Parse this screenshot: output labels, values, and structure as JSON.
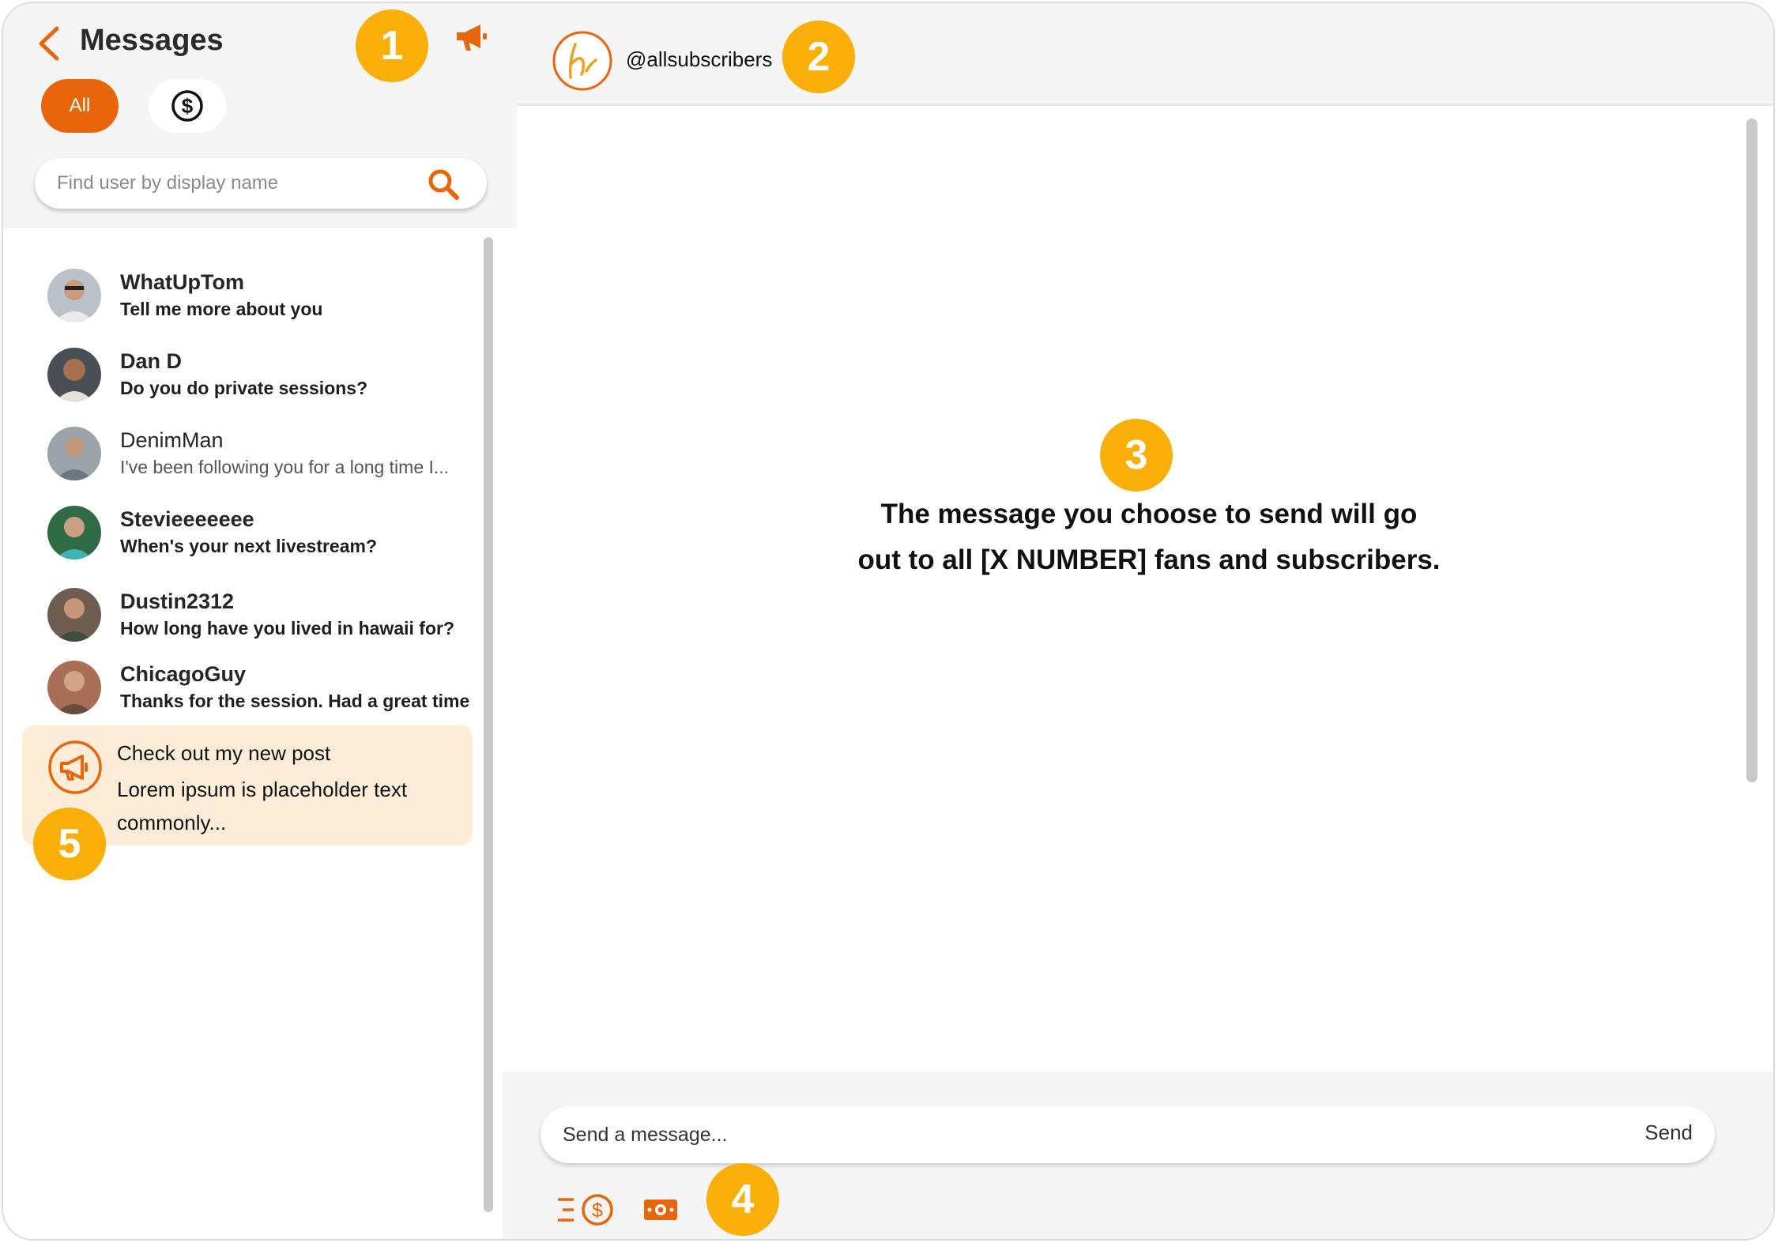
{
  "sidebar": {
    "title": "Messages",
    "filters": {
      "all_label": "All"
    },
    "search": {
      "placeholder": "Find user by display name"
    },
    "conversations": [
      {
        "name": "WhatUpTom",
        "message": "Tell me more about you",
        "unread": true
      },
      {
        "name": "Dan D",
        "message": "Do you do private sessions?",
        "unread": true
      },
      {
        "name": "DenimMan",
        "message": "I've been following you for a long time I...",
        "unread": false
      },
      {
        "name": "Stevieeeeeee",
        "message": "When's your next livestream?",
        "unread": true
      },
      {
        "name": "Dustin2312",
        "message": "How long have you lived in hawaii for?",
        "unread": true
      },
      {
        "name": "ChicagoGuy",
        "message": "Thanks for the session. Had a great time",
        "unread": true
      }
    ],
    "broadcast": {
      "title": "Check out my new post",
      "text": "Lorem ipsum is placeholder text commonly..."
    }
  },
  "chat": {
    "handle": "@allsubscribers",
    "notice": "The message you choose to send will go out to all [X NUMBER] fans and subscribers.",
    "composer": {
      "placeholder": "Send a message...",
      "send_label": "Send"
    }
  },
  "markers": [
    "1",
    "2",
    "3",
    "4",
    "5"
  ],
  "colors": {
    "accent": "#e8650a",
    "marker": "#f9ae08",
    "panel": "#f5f5f5",
    "highlight": "#fdedd8"
  },
  "icons": {
    "back": "chevron-left-icon",
    "broadcast": "megaphone-icon",
    "paid_filter": "dollar-circle-icon",
    "search": "search-icon",
    "tip": "tip-menu-icon",
    "cash": "cash-icon"
  }
}
